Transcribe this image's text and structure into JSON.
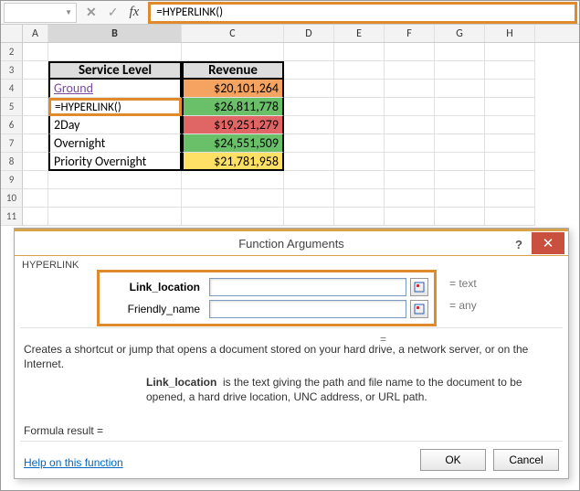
{
  "formula_bar": {
    "namebox": "",
    "formula": "=HYPERLINK()"
  },
  "columns": [
    "A",
    "B",
    "C",
    "D",
    "E",
    "F",
    "G",
    "H"
  ],
  "rows": [
    "2",
    "3",
    "4",
    "5",
    "6",
    "7",
    "8",
    "9",
    "10",
    "11"
  ],
  "table": {
    "headers": {
      "b": "Service Level",
      "c": "Revenue"
    },
    "rows": [
      {
        "b": "Ground",
        "c": "$20,101,264",
        "fill": "fill-orange",
        "link": true
      },
      {
        "b": "=HYPERLINK()",
        "c": "$26,811,778",
        "fill": "fill-green",
        "editing": true
      },
      {
        "b": "2Day",
        "c": "$19,251,279",
        "fill": "fill-red"
      },
      {
        "b": "Overnight",
        "c": "$24,551,509",
        "fill": "fill-green"
      },
      {
        "b": "Priority Overnight",
        "c": "$21,781,958",
        "fill": "fill-yellow"
      }
    ]
  },
  "chart_data": {
    "type": "table",
    "columns": [
      "Service Level",
      "Revenue"
    ],
    "rows": [
      [
        "Ground",
        20101264
      ],
      [
        "",
        26811778
      ],
      [
        "2Day",
        19251279
      ],
      [
        "Overnight",
        24551509
      ],
      [
        "Priority Overnight",
        21781958
      ]
    ]
  },
  "dialog": {
    "title": "Function Arguments",
    "function": "HYPERLINK",
    "args": [
      {
        "label": "Link_location",
        "value": "",
        "hint": "= text"
      },
      {
        "label": "Friendly_name",
        "value": "",
        "hint": "= any"
      }
    ],
    "preview": "=",
    "description": "Creates a shortcut or jump that opens a document stored on your hard drive, a network server, or on the Internet.",
    "arg_help_label": "Link_location",
    "arg_help_text": "is the text giving the path and file name to the document to be opened, a hard drive location, UNC address, or URL path.",
    "formula_result_label": "Formula result =",
    "help_link": "Help on this function",
    "ok": "OK",
    "cancel": "Cancel"
  }
}
